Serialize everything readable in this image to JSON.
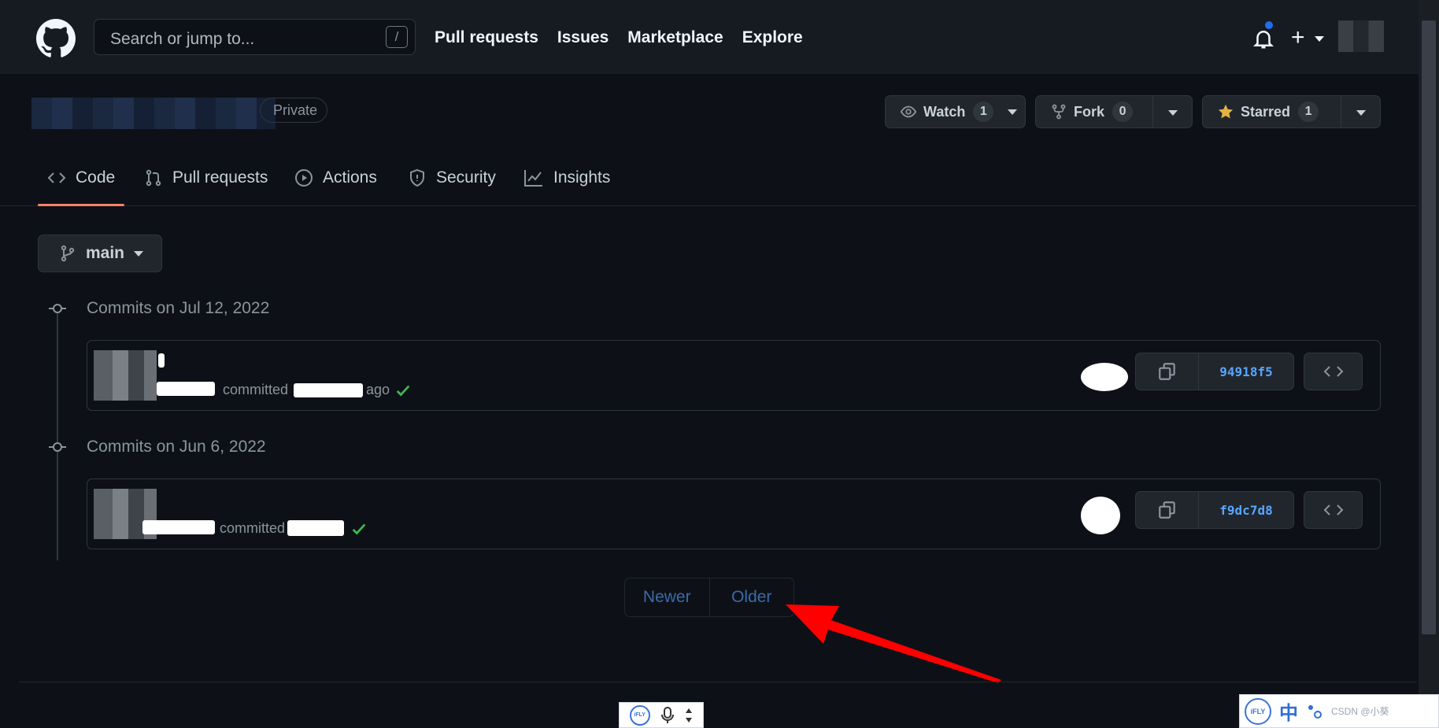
{
  "header": {
    "search_placeholder": "Search or jump to...",
    "search_shortcut": "/",
    "nav": [
      "Pull requests",
      "Issues",
      "Marketplace",
      "Explore"
    ]
  },
  "repo": {
    "visibility": "Private",
    "watch": {
      "label": "Watch",
      "count": "1"
    },
    "fork": {
      "label": "Fork",
      "count": "0"
    },
    "star": {
      "label": "Starred",
      "count": "1"
    }
  },
  "tabs": [
    "Code",
    "Pull requests",
    "Actions",
    "Security",
    "Insights"
  ],
  "active_tab": "Code",
  "branch": "main",
  "commit_groups": [
    {
      "title": "Commits on Jul 12, 2022",
      "commits": [
        {
          "meta_text": "committed",
          "meta_suffix": "ago",
          "sha": "94918f5",
          "status": "success"
        }
      ]
    },
    {
      "title": "Commits on Jun 6, 2022",
      "commits": [
        {
          "meta_text": "committed",
          "meta_suffix": "",
          "sha": "f9dc7d8",
          "status": "success"
        }
      ]
    }
  ],
  "pagination": {
    "newer": "Newer",
    "older": "Older"
  },
  "ime": {
    "logo": "iFLY",
    "lang": "中",
    "watermark": "CSDN @小葵"
  },
  "colors": {
    "background": "#0d1117",
    "header_bg": "#161b22",
    "active_tab_underline": "#f78166",
    "link": "#58a6ff",
    "success": "#3fb950",
    "annotation_arrow": "#ff0000"
  }
}
